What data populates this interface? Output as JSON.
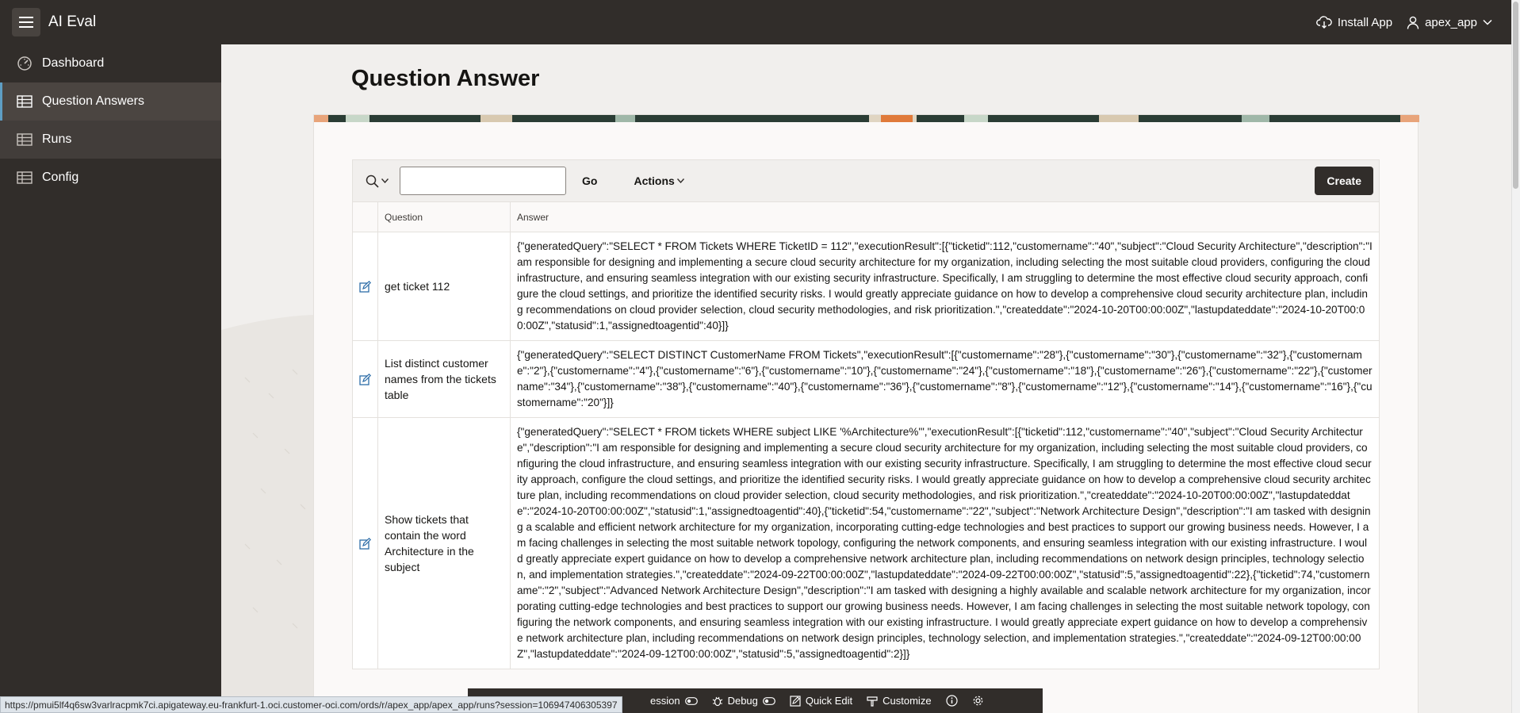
{
  "header": {
    "app_title": "AI Eval",
    "install_label": "Install App",
    "user_label": "apex_app"
  },
  "sidebar": {
    "items": [
      {
        "label": "Dashboard",
        "icon": "gauge-icon"
      },
      {
        "label": "Question Answers",
        "icon": "table-icon"
      },
      {
        "label": "Runs",
        "icon": "table-icon"
      },
      {
        "label": "Config",
        "icon": "table-icon"
      }
    ]
  },
  "page": {
    "title": "Question Answer"
  },
  "toolbar": {
    "search_value": "",
    "go_label": "Go",
    "actions_label": "Actions",
    "create_label": "Create"
  },
  "table": {
    "headers": [
      "Question",
      "Answer"
    ],
    "rows": [
      {
        "question": "get ticket 112",
        "answer": "{\"generatedQuery\":\"SELECT * FROM Tickets WHERE TicketID = 112\",\"executionResult\":[{\"ticketid\":112,\"customername\":\"40\",\"subject\":\"Cloud Security Architecture\",\"description\":\"I am responsible for designing and implementing a secure cloud security architecture for my organization, including selecting the most suitable cloud providers, configuring the cloud infrastructure, and ensuring seamless integration with our existing security infrastructure. Specifically, I am struggling to determine the most effective cloud security approach, configure the cloud settings, and prioritize the identified security risks. I would greatly appreciate guidance on how to develop a comprehensive cloud security architecture plan, including recommendations on cloud provider selection, cloud security methodologies, and risk prioritization.\",\"createddate\":\"2024-10-20T00:00:00Z\",\"lastupdateddate\":\"2024-10-20T00:00:00Z\",\"statusid\":1,\"assignedtoagentid\":40}]}"
      },
      {
        "question": "List distinct customer names from the tickets table",
        "answer": "{\"generatedQuery\":\"SELECT DISTINCT CustomerName FROM Tickets\",\"executionResult\":[{\"customername\":\"28\"},{\"customername\":\"30\"},{\"customername\":\"32\"},{\"customername\":\"2\"},{\"customername\":\"4\"},{\"customername\":\"6\"},{\"customername\":\"10\"},{\"customername\":\"24\"},{\"customername\":\"18\"},{\"customername\":\"26\"},{\"customername\":\"22\"},{\"customername\":\"34\"},{\"customername\":\"38\"},{\"customername\":\"40\"},{\"customername\":\"36\"},{\"customername\":\"8\"},{\"customername\":\"12\"},{\"customername\":\"14\"},{\"customername\":\"16\"},{\"customername\":\"20\"}]}"
      },
      {
        "question": "Show tickets that contain the word Architecture in the subject",
        "answer": "{\"generatedQuery\":\"SELECT * FROM tickets WHERE subject LIKE '%Architecture%'\",\"executionResult\":[{\"ticketid\":112,\"customername\":\"40\",\"subject\":\"Cloud Security Architecture\",\"description\":\"I am responsible for designing and implementing a secure cloud security architecture for my organization, including selecting the most suitable cloud providers, configuring the cloud infrastructure, and ensuring seamless integration with our existing security infrastructure. Specifically, I am struggling to determine the most effective cloud security approach, configure the cloud settings, and prioritize the identified security risks. I would greatly appreciate guidance on how to develop a comprehensive cloud security architecture plan, including recommendations on cloud provider selection, cloud security methodologies, and risk prioritization.\",\"createddate\":\"2024-10-20T00:00:00Z\",\"lastupdateddate\":\"2024-10-20T00:00:00Z\",\"statusid\":1,\"assignedtoagentid\":40},{\"ticketid\":54,\"customername\":\"22\",\"subject\":\"Network Architecture Design\",\"description\":\"I am tasked with designing a scalable and efficient network architecture for my organization, incorporating cutting-edge technologies and best practices to support our growing business needs. However, I am facing challenges in selecting the most suitable network topology, configuring the network components, and ensuring seamless integration with our existing infrastructure. I would greatly appreciate expert guidance on how to develop a comprehensive network architecture plan, including recommendations on network design principles, technology selection, and implementation strategies.\",\"createddate\":\"2024-09-22T00:00:00Z\",\"lastupdateddate\":\"2024-09-22T00:00:00Z\",\"statusid\":5,\"assignedtoagentid\":22},{\"ticketid\":74,\"customername\":\"2\",\"subject\":\"Advanced Network Architecture Design\",\"description\":\"I am tasked with designing a highly available and scalable network architecture for my organization, incorporating cutting-edge technologies and best practices to support our growing business needs. However, I am facing challenges in selecting the most suitable network topology, configuring the network components, and ensuring seamless integration with our existing infrastructure. I would greatly appreciate expert guidance on how to develop a comprehensive network architecture plan, including recommendations on network design principles, technology selection, and implementation strategies.\",\"createddate\":\"2024-09-12T00:00:00Z\",\"lastupdateddate\":\"2024-09-12T00:00:00Z\",\"statusid\":5,\"assignedtoagentid\":2}]}"
      }
    ]
  },
  "status_url": "https://pmui5lf4q6sw3varlracpmk7ci.apigateway.eu-frankfurt-1.oci.customer-oci.com/ords/r/apex_app/apex_app/runs?session=106947406305397",
  "devbar": {
    "session_label": "ession",
    "debug_label": "Debug",
    "quick_edit_label": "Quick Edit",
    "customize_label": "Customize"
  },
  "colors": {
    "header_bg": "#312d2a",
    "page_bg": "#f1efed",
    "active_accent": "#5e9ec4",
    "link_blue": "#2d6da8"
  }
}
